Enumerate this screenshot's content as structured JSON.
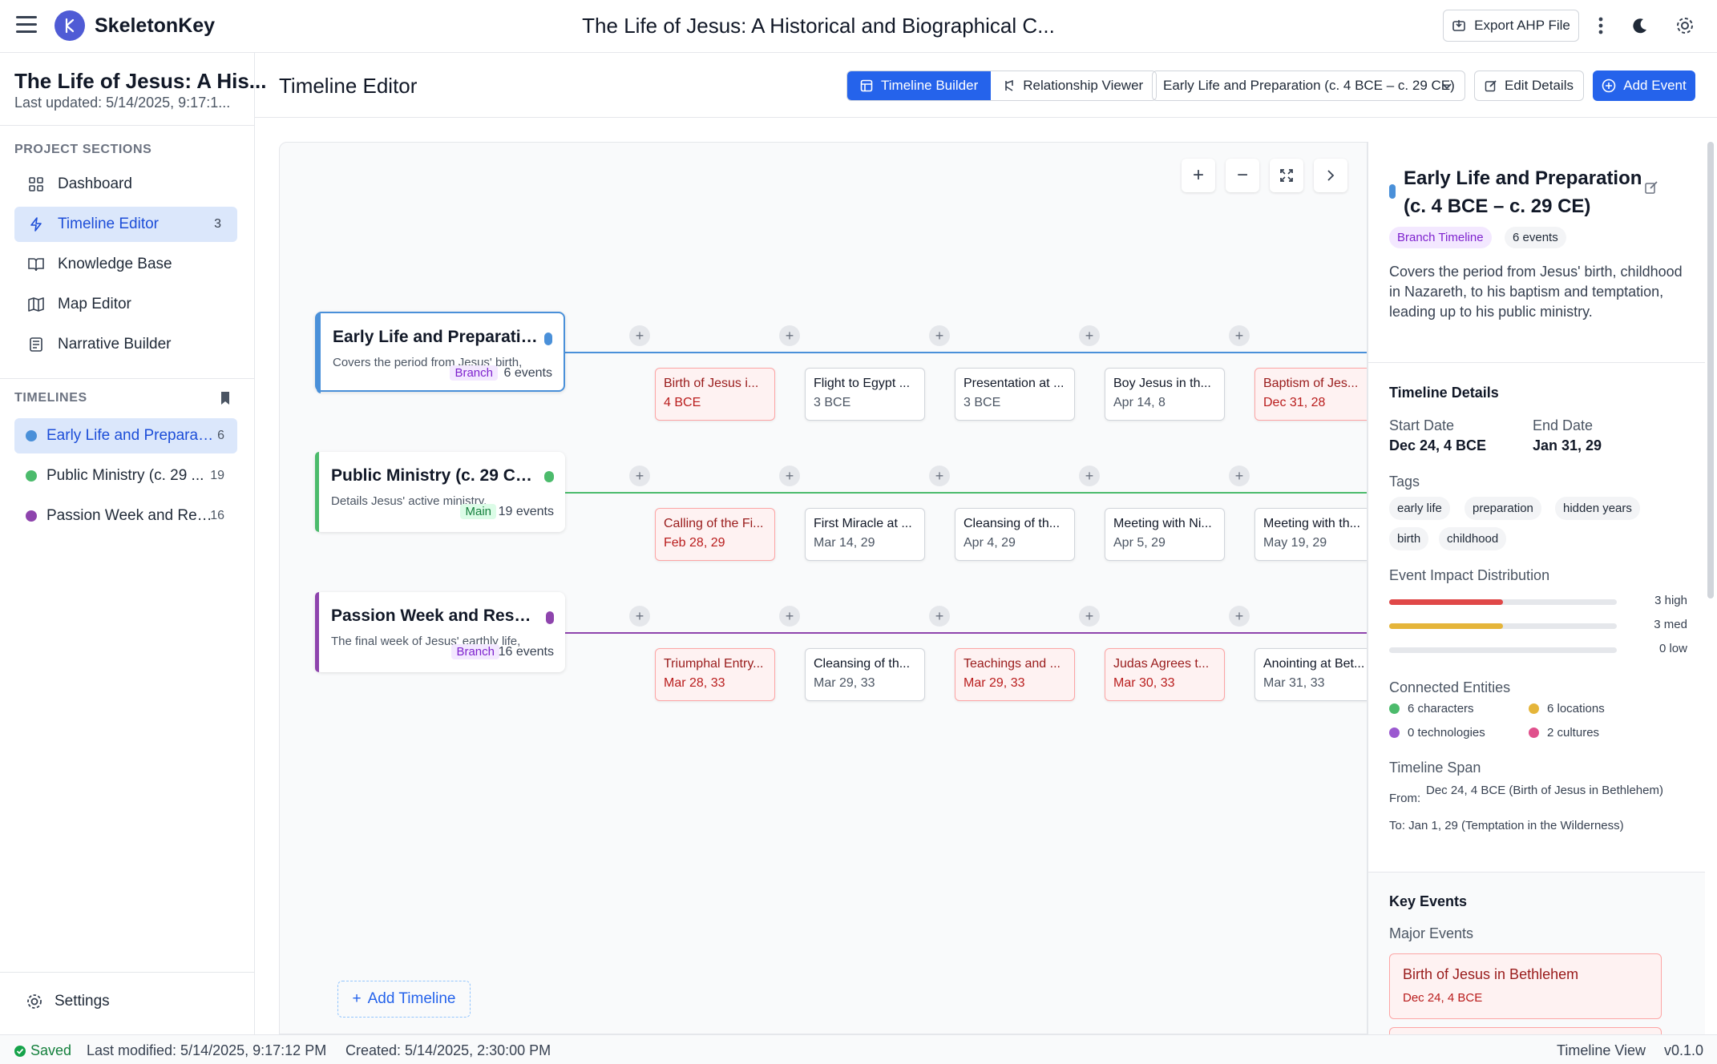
{
  "header": {
    "app_name": "SkeletonKey",
    "doc_title": "The Life of Jesus: A Historical and Biographical C...",
    "export_label": "Export AHP File"
  },
  "sidebar": {
    "project_title": "The Life of Jesus: A His...",
    "last_updated": "Last updated: 5/14/2025, 9:17:1...",
    "sections_label": "PROJECT SECTIONS",
    "nav": [
      {
        "label": "Dashboard",
        "icon": "grid-icon"
      },
      {
        "label": "Timeline Editor",
        "icon": "lightning-icon",
        "count": "3"
      },
      {
        "label": "Knowledge Base",
        "icon": "book-icon"
      },
      {
        "label": "Map Editor",
        "icon": "map-icon"
      },
      {
        "label": "Narrative Builder",
        "icon": "document-icon"
      }
    ],
    "timelines_label": "TIMELINES",
    "timelines": [
      {
        "label": "Early Life and Preparati...",
        "count": "6",
        "color": "#4a90d9"
      },
      {
        "label": "Public Ministry (c. 29 ...",
        "count": "19",
        "color": "#4cbb6c"
      },
      {
        "label": "Passion Week and Res...",
        "count": "16",
        "color": "#8e44ad"
      }
    ],
    "settings_label": "Settings"
  },
  "toolbar": {
    "title": "Timeline Editor",
    "builder_label": "Timeline Builder",
    "viewer_label": "Relationship Viewer",
    "selected_timeline": "Early Life and Preparation (c. 4 BCE – c. 29 CE)",
    "edit_label": "Edit Details",
    "add_event_label": "Add Event"
  },
  "canvas": {
    "timelines": [
      {
        "title": "Early Life and Preparation...",
        "desc": "Covers the period from Jesus' birth,",
        "type": "Branch",
        "events_count": "6 events",
        "color": "#4a90d9",
        "events": [
          {
            "title": "Birth of Jesus i...",
            "date": "4 BCE",
            "impact": "high"
          },
          {
            "title": "Flight to Egypt ...",
            "date": "3 BCE",
            "impact": "normal"
          },
          {
            "title": "Presentation at ...",
            "date": "3 BCE",
            "impact": "normal"
          },
          {
            "title": "Boy Jesus in th...",
            "date": "Apr 14, 8",
            "impact": "normal"
          },
          {
            "title": "Baptism of Jes...",
            "date": "Dec 31, 28",
            "impact": "high"
          }
        ]
      },
      {
        "title": "Public Ministry (c. 29 CE ...",
        "desc": "Details Jesus' active ministry,",
        "type": "Main",
        "events_count": "19 events",
        "color": "#4cbb6c",
        "events": [
          {
            "title": "Calling of the Fi...",
            "date": "Feb 28, 29",
            "impact": "high"
          },
          {
            "title": "First Miracle at ...",
            "date": "Mar 14, 29",
            "impact": "normal"
          },
          {
            "title": "Cleansing of th...",
            "date": "Apr 4, 29",
            "impact": "normal"
          },
          {
            "title": "Meeting with Ni...",
            "date": "Apr 5, 29",
            "impact": "normal"
          },
          {
            "title": "Meeting with th...",
            "date": "May 19, 29",
            "impact": "normal"
          }
        ]
      },
      {
        "title": "Passion Week and Resurr...",
        "desc": "The final week of Jesus' earthly life,",
        "type": "Branch",
        "events_count": "16 events",
        "color": "#8e44ad",
        "events": [
          {
            "title": "Triumphal Entry...",
            "date": "Mar 28, 33",
            "impact": "high"
          },
          {
            "title": "Cleansing of th...",
            "date": "Mar 29, 33",
            "impact": "normal"
          },
          {
            "title": "Teachings and ...",
            "date": "Mar 29, 33",
            "impact": "high"
          },
          {
            "title": "Judas Agrees t...",
            "date": "Mar 30, 33",
            "impact": "high"
          },
          {
            "title": "Anointing at Bet...",
            "date": "Mar 31, 33",
            "impact": "normal"
          }
        ]
      }
    ],
    "add_timeline_label": "Add Timeline",
    "zoom_in": "+",
    "zoom_out": "−"
  },
  "details": {
    "title": "Early Life and Preparation (c. 4 BCE – c. 29 CE)",
    "type_badge": "Branch Timeline",
    "events_badge": "6 events",
    "description": "Covers the period from Jesus' birth, childhood in Nazareth, to his baptism and temptation, leading up to his public ministry.",
    "details_heading": "Timeline Details",
    "start_label": "Start Date",
    "start_value": "Dec 24, 4 BCE",
    "end_label": "End Date",
    "end_value": "Jan 31, 29",
    "tags_label": "Tags",
    "tags": [
      "early life",
      "preparation",
      "hidden years",
      "birth",
      "childhood"
    ],
    "impact_label": "Event Impact Distribution",
    "impact": [
      {
        "label": "3 high",
        "fraction": 0.5,
        "color": "#e04848"
      },
      {
        "label": "3 med",
        "fraction": 0.5,
        "color": "#e5b53a"
      },
      {
        "label": "0 low",
        "fraction": 0,
        "color": "#9ca3af"
      }
    ],
    "entities_label": "Connected Entities",
    "entities": [
      {
        "label": "6 characters",
        "color": "#4cbb6c"
      },
      {
        "label": "6 locations",
        "color": "#e5b53a"
      },
      {
        "label": "0 technologies",
        "color": "#9b59d0"
      },
      {
        "label": "2 cultures",
        "color": "#e0508c"
      }
    ],
    "span_label": "Timeline Span",
    "span_from_label": "From:",
    "span_from": "Dec 24, 4 BCE (Birth of Jesus in Bethlehem)",
    "span_to": "To: Jan 1, 29 (Temptation in the Wilderness)",
    "key_events_heading": "Key Events",
    "major_events_label": "Major Events",
    "key_event_title": "Birth of Jesus in Bethlehem",
    "key_event_date": "Dec 24, 4 BCE"
  },
  "status": {
    "saved": "Saved",
    "modified": "Last modified: 5/14/2025, 9:17:12 PM",
    "created": "Created: 5/14/2025, 2:30:00 PM",
    "view": "Timeline View",
    "version": "v0.1.0"
  }
}
